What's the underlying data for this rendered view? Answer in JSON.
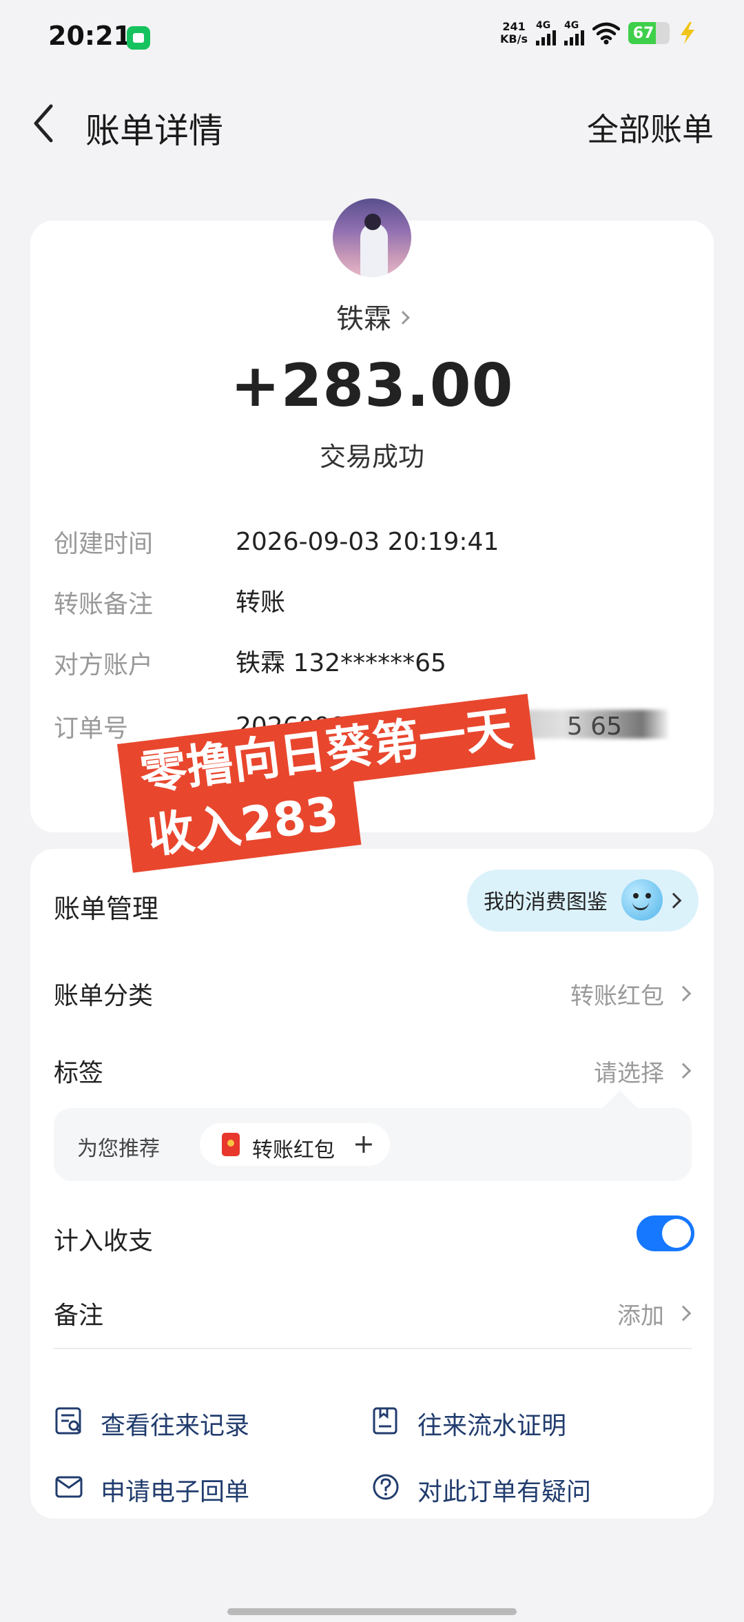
{
  "status_bar": {
    "time": "20:21",
    "net_speed_value": "241",
    "net_speed_unit": "KB/s",
    "signal1": "4G",
    "signal2": "4G",
    "battery_level": "67",
    "battery_fraction": 0.67
  },
  "header": {
    "title": "账单详情",
    "all_bills_label": "全部账单"
  },
  "detail": {
    "payer_name": "铁霖",
    "amount": "+283.00",
    "status": "交易成功",
    "rows": [
      {
        "label": "创建时间",
        "value": "2026-09-03 20:19:41"
      },
      {
        "label": "转账备注",
        "value": "转账"
      },
      {
        "label": "对方账户",
        "value": "铁霖 132******65"
      },
      {
        "label": "订单号",
        "value": "20260903209                    5 65"
      }
    ]
  },
  "manage": {
    "title": "账单管理",
    "atlas_label": "我的消费图鉴",
    "category": {
      "label": "账单分类",
      "value": "转账红包"
    },
    "tag": {
      "label": "标签",
      "value": "请选择"
    },
    "recommend": {
      "label": "为您推荐",
      "chip": "转账红包",
      "plus": "+"
    },
    "count_in": {
      "label": "计入收支",
      "enabled": true
    },
    "remark": {
      "label": "备注",
      "value": "添加"
    },
    "actions": [
      {
        "label": "查看往来记录",
        "icon": "records-icon"
      },
      {
        "label": "往来流水证明",
        "icon": "statement-icon"
      },
      {
        "label": "申请电子回单",
        "icon": "mail-icon"
      },
      {
        "label": "对此订单有疑问",
        "icon": "question-icon"
      }
    ]
  },
  "overlay": {
    "line1": "零撸向日葵第一天",
    "line2": "收入283"
  },
  "colors": {
    "accent_blue": "#1677ff",
    "banner_red": "#e8472e",
    "link_navy": "#213c6e"
  }
}
